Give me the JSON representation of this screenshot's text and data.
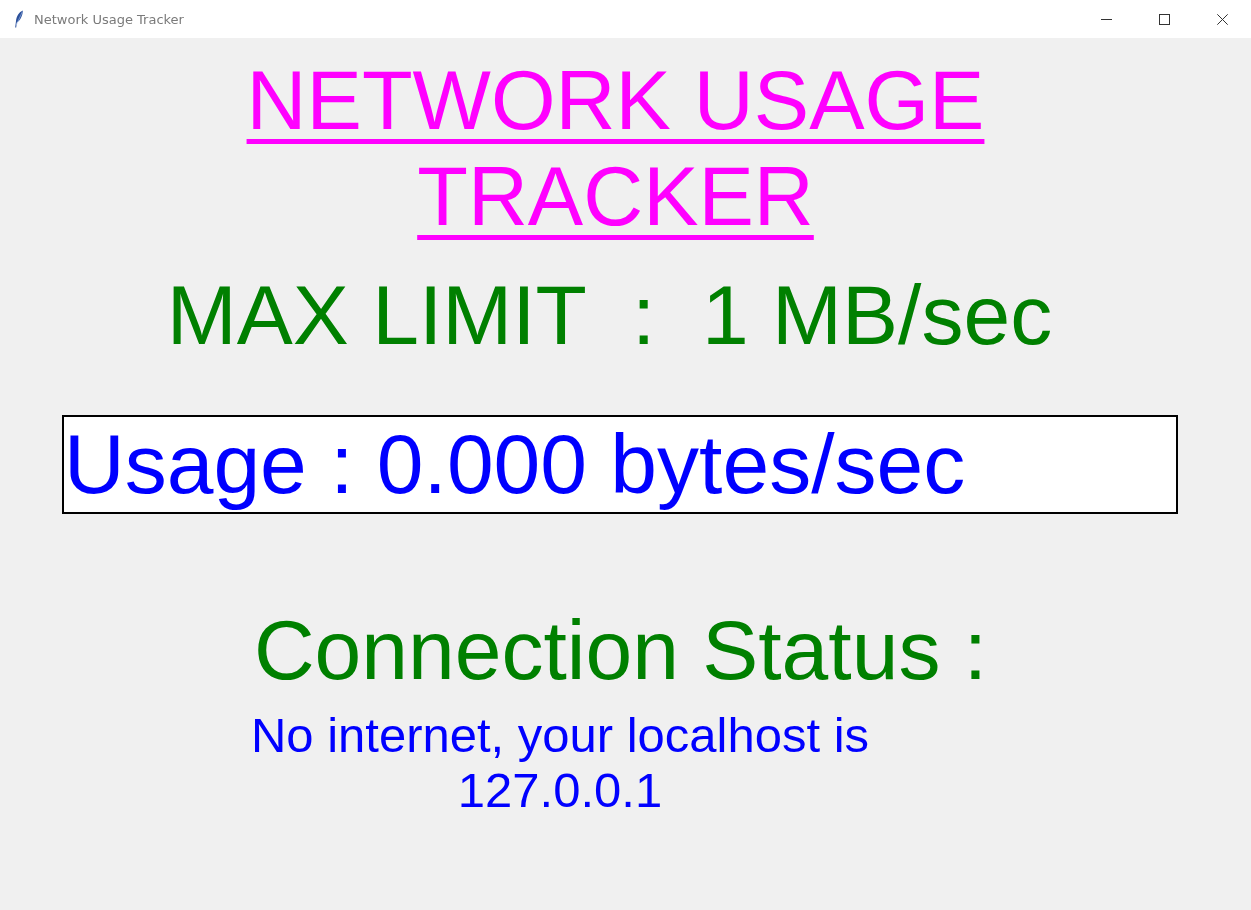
{
  "window": {
    "title": "Network Usage Tracker"
  },
  "heading": "NETWORK USAGE TRACKER",
  "max_limit": "MAX LIMIT  :  1 MB/sec",
  "usage": {
    "value": "Usage : 0.000 bytes/sec"
  },
  "connection": {
    "label": "Connection Status :",
    "message": "No internet, your localhost is 127.0.0.1"
  }
}
